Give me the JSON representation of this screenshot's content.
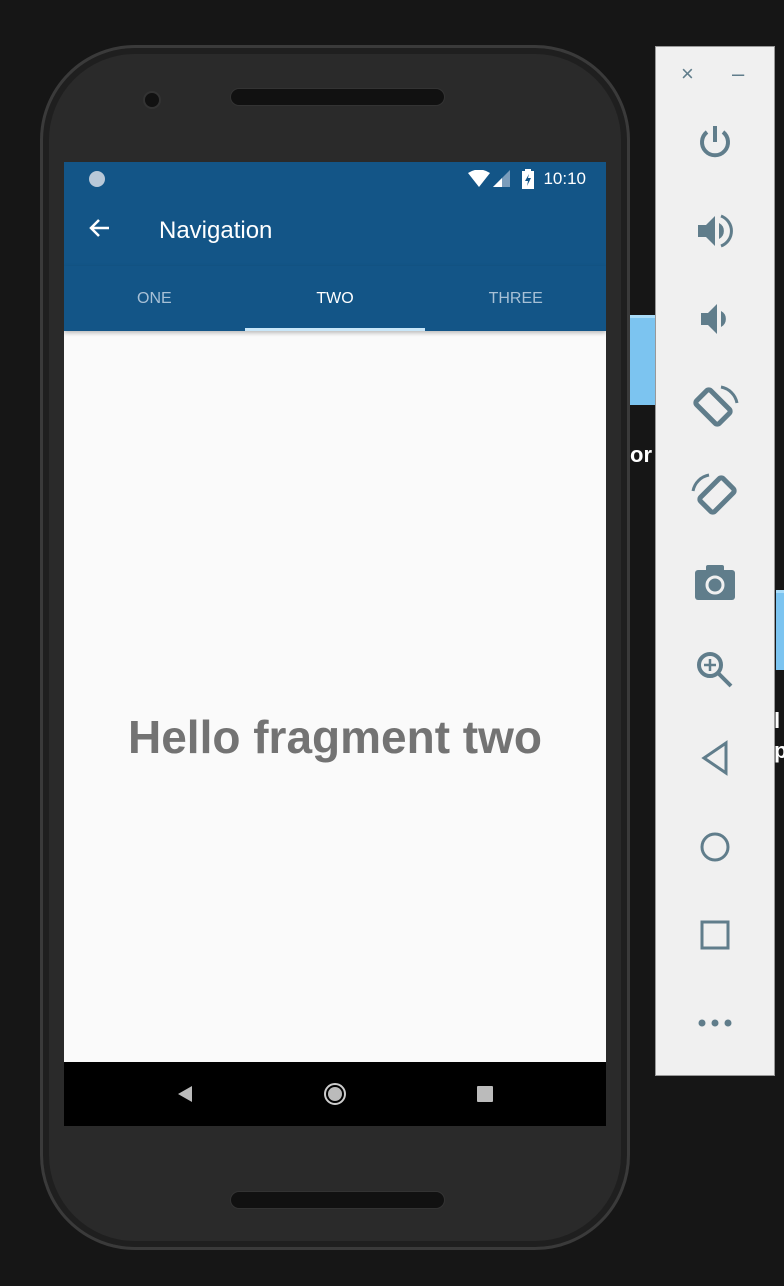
{
  "status_bar": {
    "time": "10:10"
  },
  "toolbar": {
    "title": "Navigation",
    "back_icon": "arrow-back-icon"
  },
  "tabs": [
    {
      "label": "ONE",
      "active": false
    },
    {
      "label": "TWO",
      "active": true
    },
    {
      "label": "THREE",
      "active": false
    }
  ],
  "content": {
    "text": "Hello fragment two"
  },
  "colors": {
    "primary": "#135587",
    "indicator": "#c8e6f8",
    "panel_icon": "#607d8b"
  },
  "emulator_panel": {
    "close": "×",
    "minimize": "–",
    "buttons": [
      "power",
      "volume-up",
      "volume-down",
      "rotate-left",
      "rotate-right",
      "screenshot",
      "zoom",
      "back",
      "home",
      "overview",
      "more"
    ]
  },
  "background": {
    "text_fragments": [
      "or",
      "l",
      "p"
    ]
  }
}
